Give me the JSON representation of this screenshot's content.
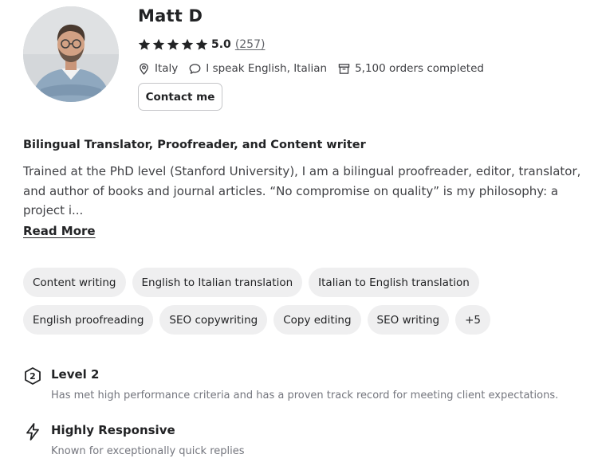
{
  "profile": {
    "name": "Matt D",
    "rating": {
      "value": "5.0",
      "count": "(257)",
      "stars": 5,
      "star_color": "#222325"
    },
    "meta": {
      "location": "Italy",
      "languages": "I speak English, Italian",
      "orders": "5,100 orders completed"
    },
    "contact_label": "Contact me",
    "headline": "Bilingual Translator, Proofreader, and Content writer",
    "description": "Trained at the PhD level (Stanford University), I am a bilingual proofreader, editor, translator, and author of books and journal articles. “No compromise on quality” is my philosophy: a project i...",
    "read_more": "Read More"
  },
  "skills": {
    "row1": [
      "Content writing",
      "English to Italian translation",
      "Italian to English translation"
    ],
    "row2": [
      "English proofreading",
      "SEO copywriting",
      "Copy editing",
      "SEO writing",
      "+5"
    ]
  },
  "badges": {
    "level": {
      "icon": "level-2-icon",
      "title": "Level 2",
      "description": "Has met high performance criteria and has a proven track record for meeting client expectations."
    },
    "responsive": {
      "icon": "lightning-icon",
      "title": "Highly Responsive",
      "description": "Known for exceptionally quick replies"
    }
  },
  "colors": {
    "text_primary": "#222325",
    "text_secondary": "#74767e",
    "chip_background": "#efeff0",
    "border": "#c5c6c9"
  }
}
